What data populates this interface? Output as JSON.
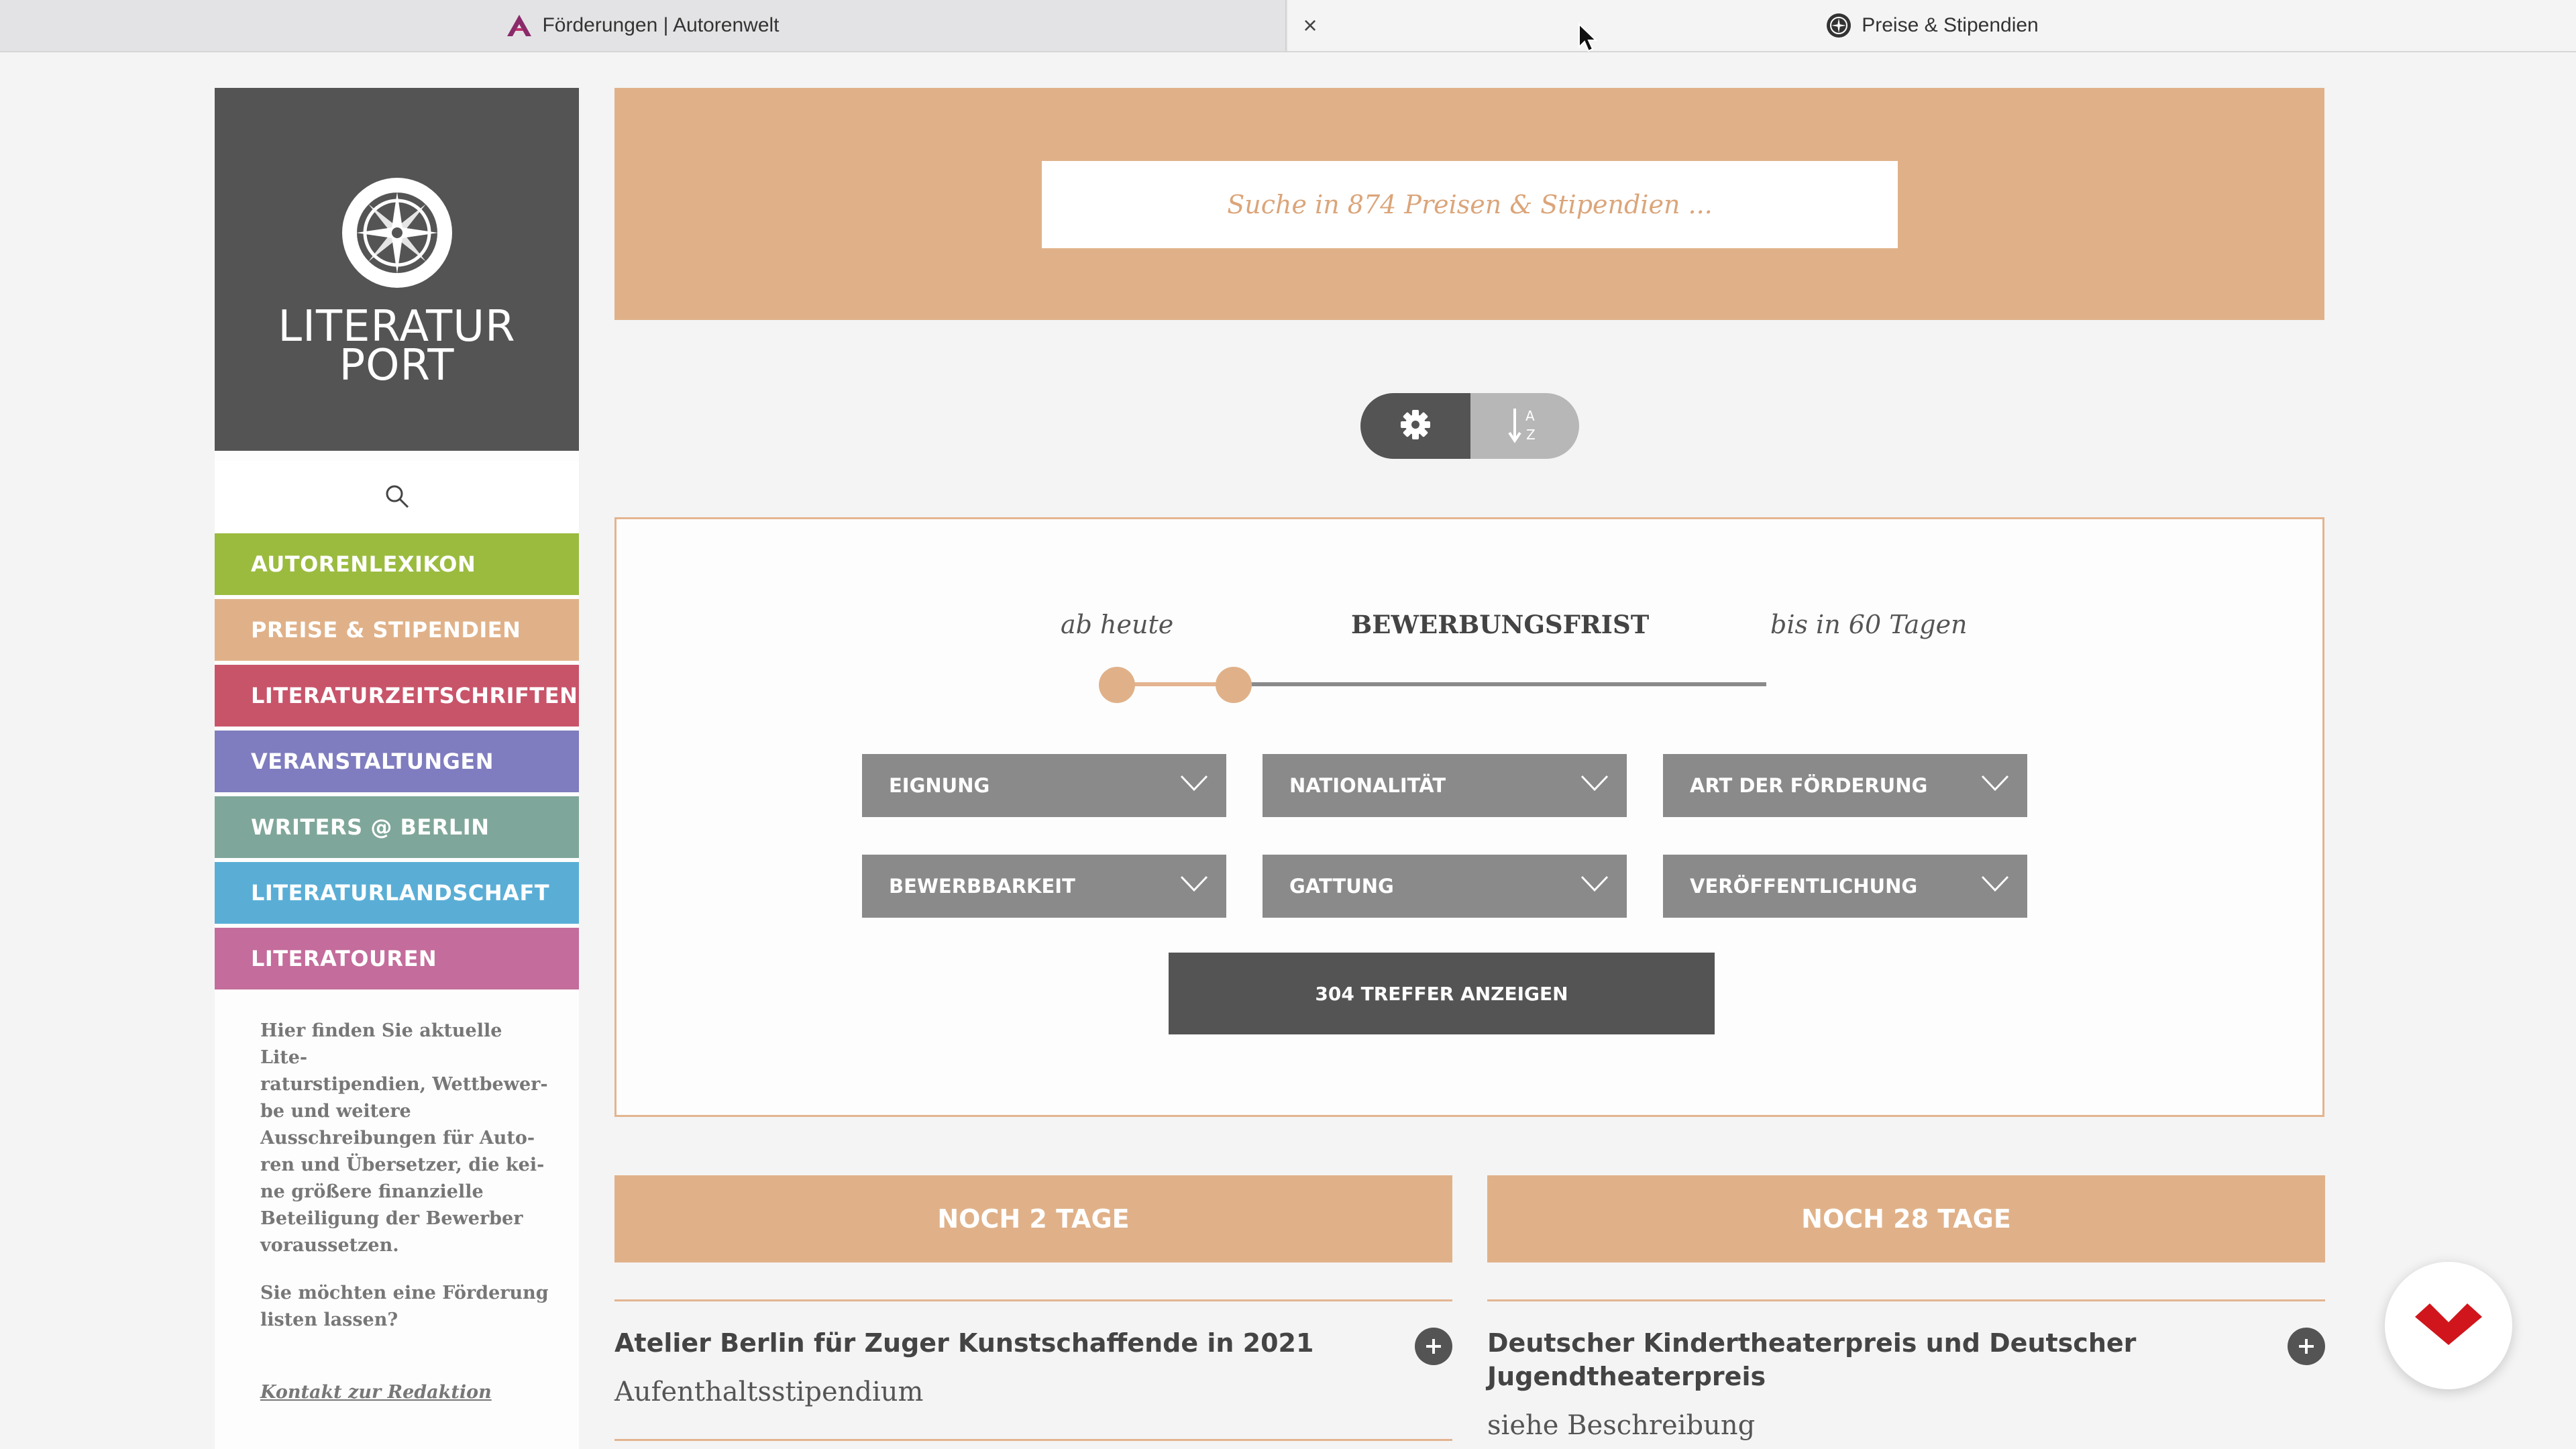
{
  "browser": {
    "tab1_title": "Förderungen | Autorenwelt",
    "tab2_title": "Preise & Stipendien",
    "tab_close_symbol": "×"
  },
  "sidebar": {
    "logo_line1": "LITERATUR",
    "logo_line2": "PORT",
    "search_icon": "search-icon",
    "nav": [
      {
        "label": "AUTORENLEXIKON",
        "color": "#9bbb3f"
      },
      {
        "label": "PREISE & STIPENDIEN",
        "color": "#e0b189"
      },
      {
        "label": "LITERATURZEITSCHRIFTEN",
        "color": "#c8546a"
      },
      {
        "label": "VERANSTALTUNGEN",
        "color": "#7f7cbf"
      },
      {
        "label": "WRITERS @ BERLIN",
        "color": "#7fa69a"
      },
      {
        "label": "LITERATURLANDSCHAFT",
        "color": "#5aaed6"
      },
      {
        "label": "LITERATOUREN",
        "color": "#c46c9c"
      }
    ],
    "info_lines": [
      "Hier finden Sie aktuelle Lite-",
      "raturstipendien, Wettbewer-",
      "be und weitere",
      "Ausschreibungen für Auto-",
      "ren und Übersetzer, die kei-",
      "ne größere finanzielle",
      "Beteiligung der Bewerber",
      "voraussetzen."
    ],
    "question_lines": [
      "Sie möchten eine Förderung",
      "listen lassen?"
    ],
    "contact_link": "Kontakt zur Redaktion"
  },
  "banner": {
    "search_placeholder": "Suche in 874 Preisen & Stipendien ...",
    "color": "#e0b189"
  },
  "toolbar": {
    "settings_icon": "gear-icon",
    "sort_icon": "sort-alpha-icon"
  },
  "filters": {
    "left_label": "ab heute",
    "center_label": "BEWERBUNGSFRIST",
    "right_label": "bis in 60 Tagen",
    "dropdowns": [
      "EIGNUNG",
      "NATIONALITÄT",
      "ART DER FÖRDERUNG",
      "BEWERBBARKEIT",
      "GATTUNG",
      "VERÖFFENTLICHUNG"
    ],
    "submit_label": "304 TREFFER ANZEIGEN"
  },
  "results": [
    {
      "deadline": "NOCH 2 TAGE",
      "title": "Atelier Berlin für Zuger Kunstschaffende in 2021",
      "subtitle": "Aufenthaltsstipendium"
    },
    {
      "deadline": "NOCH 28 TAGE",
      "title_line1": "Deutscher Kindertheaterpreis und Deutscher",
      "title_line2": "Jugendtheaterpreis",
      "subtitle": "siehe Beschreibung"
    }
  ],
  "accent_color": "#e0b189",
  "dark_color": "#545454"
}
